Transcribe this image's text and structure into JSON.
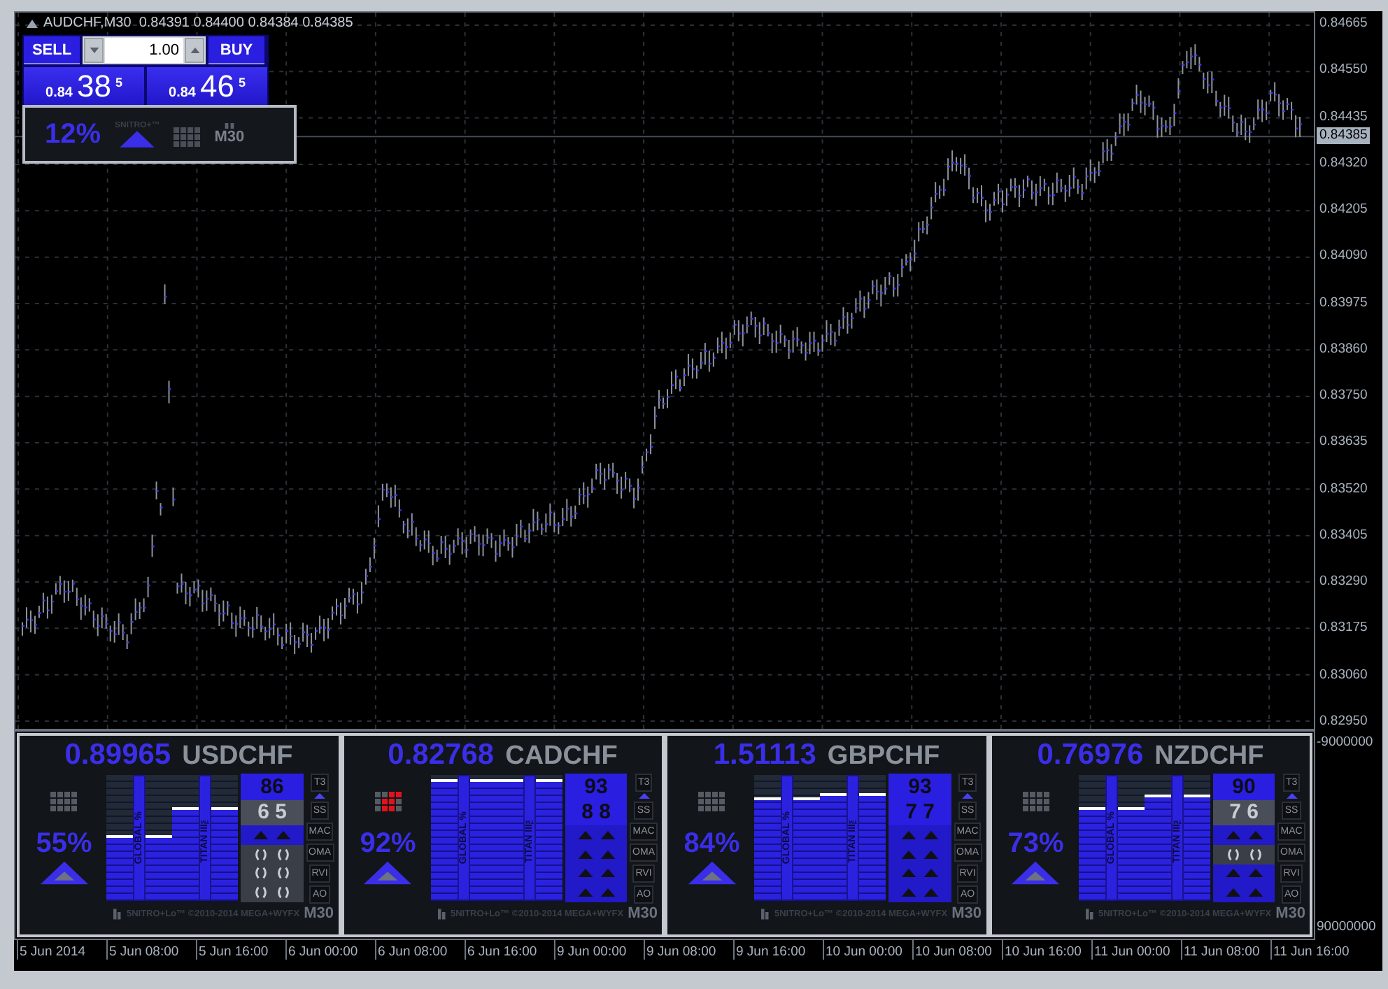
{
  "chart": {
    "title": "AUDCHF,M30  0.84391 0.84400 0.84384 0.84385"
  },
  "trade_panel": {
    "sell": "SELL",
    "buy": "BUY",
    "lot": "1.00",
    "bid": {
      "base": "0.84",
      "pips": "38",
      "point": "5"
    },
    "ask": {
      "base": "0.84",
      "pips": "46",
      "point": "5"
    }
  },
  "signal_box": {
    "percent": "12%",
    "brand": "SNITRO+™",
    "rising": true,
    "timeframe": "M30"
  },
  "price_axis": [
    "0.84665",
    "0.84550",
    "0.84435",
    "0.84320",
    "0.84205",
    "0.84090",
    "0.83975",
    "0.83860",
    "0.83750",
    "0.83635",
    "0.83520",
    "0.83405",
    "0.83290",
    "0.83175",
    "0.83060",
    "0.82950"
  ],
  "current_price": "0.84385",
  "indicator_axis": [
    "-9000000",
    "90000000"
  ],
  "time_axis": [
    "5 Jun 2014",
    "5 Jun 08:00",
    "5 Jun 16:00",
    "6 Jun 00:00",
    "6 Jun 08:00",
    "6 Jun 16:00",
    "9 Jun 00:00",
    "9 Jun 08:00",
    "9 Jun 16:00",
    "10 Jun 00:00",
    "10 Jun 08:00",
    "10 Jun 16:00",
    "11 Jun 00:00",
    "11 Jun 08:00",
    "11 Jun 16:00"
  ],
  "panels": [
    {
      "price": "0.89965",
      "symbol": "USDCHF",
      "percent": "55%",
      "rising": true,
      "grid_alert": false,
      "meters": [
        {
          "label": "GLOBAL %",
          "level": 0.52
        },
        {
          "label": "TITAN III™",
          "level": 0.74
        }
      ],
      "rows": [
        {
          "label": "T3",
          "kind": "score",
          "value": "86",
          "strong": true,
          "marker": true
        },
        {
          "label": "SS",
          "kind": "score",
          "value": "6 5",
          "strong": false
        },
        {
          "label": "MAC",
          "kind": "up"
        },
        {
          "label": "OMA",
          "kind": "neutral"
        },
        {
          "label": "RVI",
          "kind": "neutral"
        },
        {
          "label": "AO",
          "kind": "neutral"
        }
      ],
      "footer": "5NITRO+Lo™ ©2010-2014 MEGA+WYFX",
      "timeframe": "M30"
    },
    {
      "price": "0.82768",
      "symbol": "CADCHF",
      "percent": "92%",
      "rising": true,
      "grid_alert": true,
      "meters": [
        {
          "label": "GLOBAL %",
          "level": 0.97
        },
        {
          "label": "TITAN III™",
          "level": 0.97
        }
      ],
      "rows": [
        {
          "label": "T3",
          "kind": "score",
          "value": "93",
          "strong": true,
          "marker": true
        },
        {
          "label": "SS",
          "kind": "score",
          "value": "8 8",
          "strong": true
        },
        {
          "label": "MAC",
          "kind": "up"
        },
        {
          "label": "OMA",
          "kind": "up"
        },
        {
          "label": "RVI",
          "kind": "up"
        },
        {
          "label": "AO",
          "kind": "up"
        }
      ],
      "footer": "5NITRO+Lo™ ©2010-2014 MEGA+WYFX",
      "timeframe": "M30"
    },
    {
      "price": "1.51113",
      "symbol": "GBPCHF",
      "percent": "84%",
      "rising": true,
      "grid_alert": false,
      "meters": [
        {
          "label": "GLOBAL %",
          "level": 0.82
        },
        {
          "label": "TITAN III™",
          "level": 0.86
        }
      ],
      "rows": [
        {
          "label": "T3",
          "kind": "score",
          "value": "93",
          "strong": true,
          "marker": true
        },
        {
          "label": "SS",
          "kind": "score",
          "value": "7 7",
          "strong": true
        },
        {
          "label": "MAC",
          "kind": "up"
        },
        {
          "label": "OMA",
          "kind": "up"
        },
        {
          "label": "RVI",
          "kind": "up"
        },
        {
          "label": "AO",
          "kind": "up"
        }
      ],
      "footer": "5NITRO+Lo™ ©2010-2014 MEGA+WYFX",
      "timeframe": "M30"
    },
    {
      "price": "0.76976",
      "symbol": "NZDCHF",
      "percent": "73%",
      "rising": true,
      "grid_alert": false,
      "meters": [
        {
          "label": "GLOBAL %",
          "level": 0.74
        },
        {
          "label": "TITAN III™",
          "level": 0.85
        }
      ],
      "rows": [
        {
          "label": "T3",
          "kind": "score",
          "value": "90",
          "strong": true,
          "marker": true
        },
        {
          "label": "SS",
          "kind": "score",
          "value": "7 6",
          "strong": false
        },
        {
          "label": "MAC",
          "kind": "up"
        },
        {
          "label": "OMA",
          "kind": "neutral"
        },
        {
          "label": "RVI",
          "kind": "up"
        },
        {
          "label": "AO",
          "kind": "up"
        }
      ],
      "footer": "5NITRO+Lo™ ©2010-2014 MEGA+WYFX",
      "timeframe": "M30"
    }
  ]
}
